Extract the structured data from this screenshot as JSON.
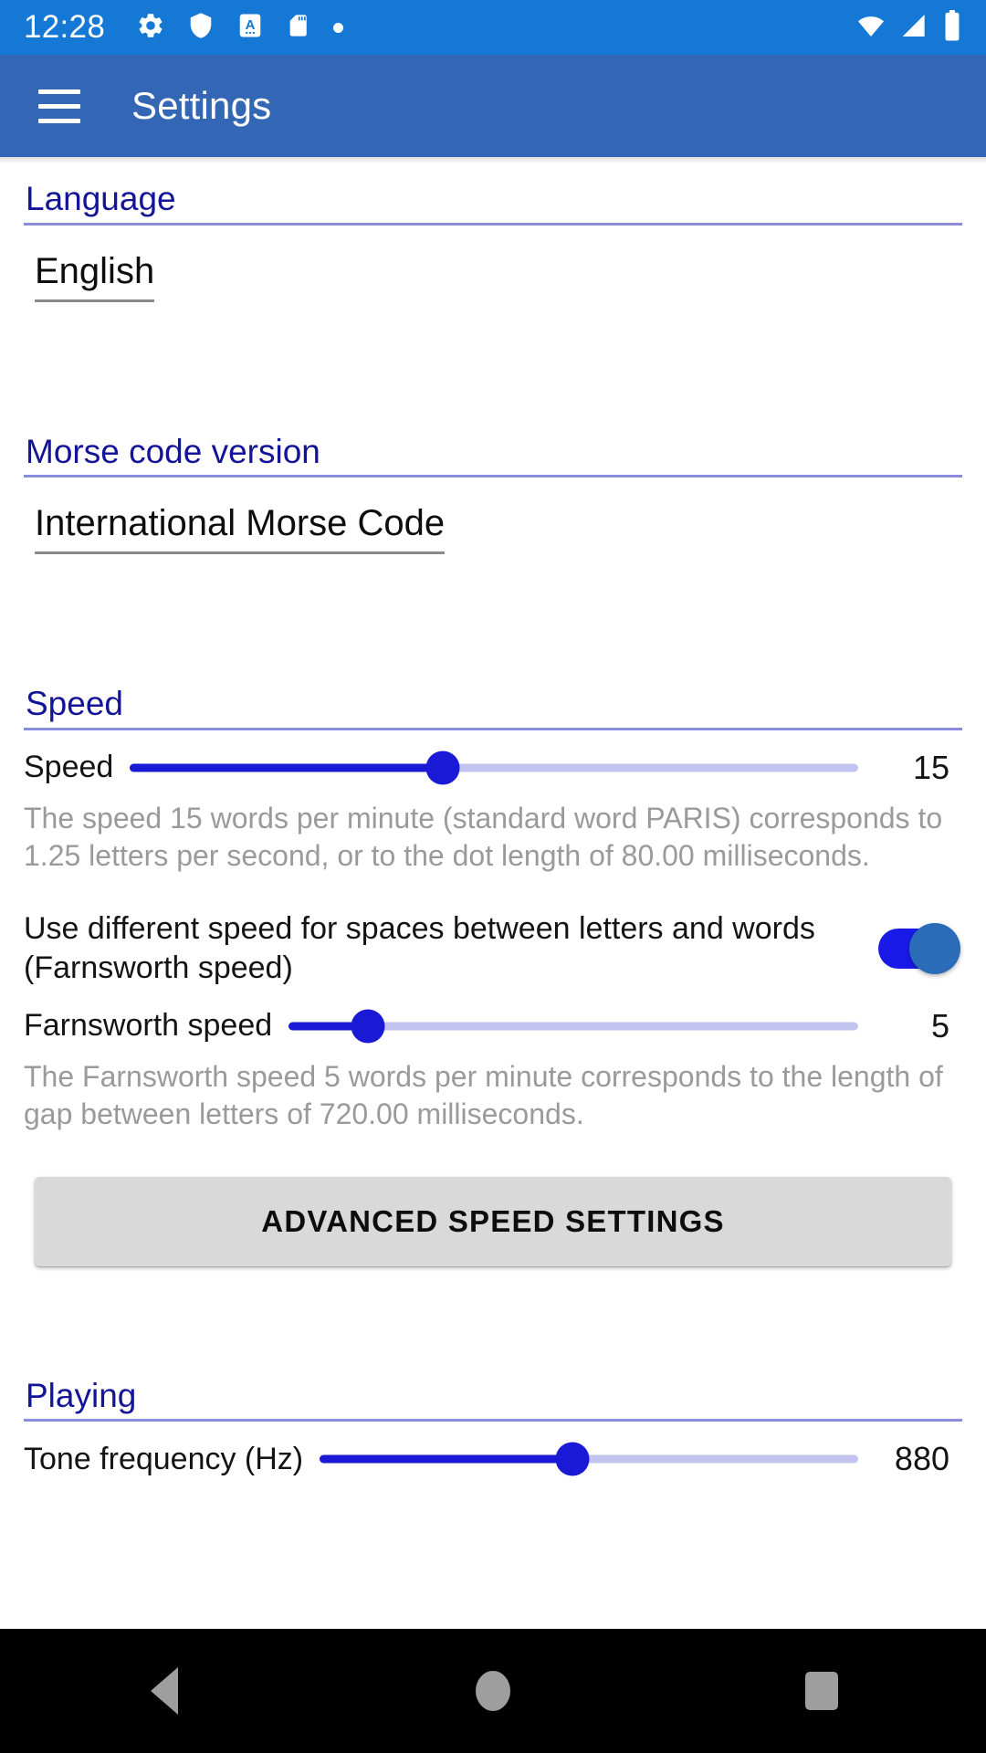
{
  "status_bar": {
    "clock": "12:28",
    "left_icons": [
      "gear-icon",
      "shield-icon",
      "translate-a-icon",
      "sd-card-icon",
      "dot-icon"
    ],
    "right_icons": [
      "wifi-icon",
      "cellular-signal-icon",
      "battery-icon"
    ],
    "background_color": "#1478d4"
  },
  "app_bar": {
    "title": "Settings",
    "menu_icon": "hamburger-menu-icon",
    "background_color": "#3367b5"
  },
  "sections": {
    "language": {
      "title": "Language",
      "value": "English"
    },
    "morse_version": {
      "title": "Morse code version",
      "value": "International Morse Code"
    },
    "speed": {
      "title": "Speed",
      "speed_label": "Speed",
      "speed_value": "15",
      "speed_percent": 43,
      "speed_helper": "The speed 15 words per minute (standard word PARIS) corresponds to 1.25 letters per second, or to the dot length of 80.00 milliseconds.",
      "farnsworth_toggle_label": "Use different speed for spaces between letters and words (Farnsworth speed)",
      "farnsworth_toggle_on": true,
      "farnsworth_label": "Farnsworth speed",
      "farnsworth_value": "5",
      "farnsworth_percent": 14,
      "farnsworth_helper": "The Farnsworth speed 5 words per minute corresponds to the length of gap between letters of 720.00 milliseconds.",
      "advanced_button": "ADVANCED SPEED SETTINGS"
    },
    "playing": {
      "title": "Playing",
      "tone_label": "Tone frequency (Hz)",
      "tone_value": "880",
      "tone_percent": 47
    }
  },
  "nav_bar": {
    "back": "back-icon",
    "home": "home-icon",
    "recents": "recents-icon"
  },
  "colors": {
    "accent_blue": "#1a1ad6",
    "section_heading": "#141499",
    "rule": "#8b8be0",
    "helper_text": "#9a9a9a"
  }
}
